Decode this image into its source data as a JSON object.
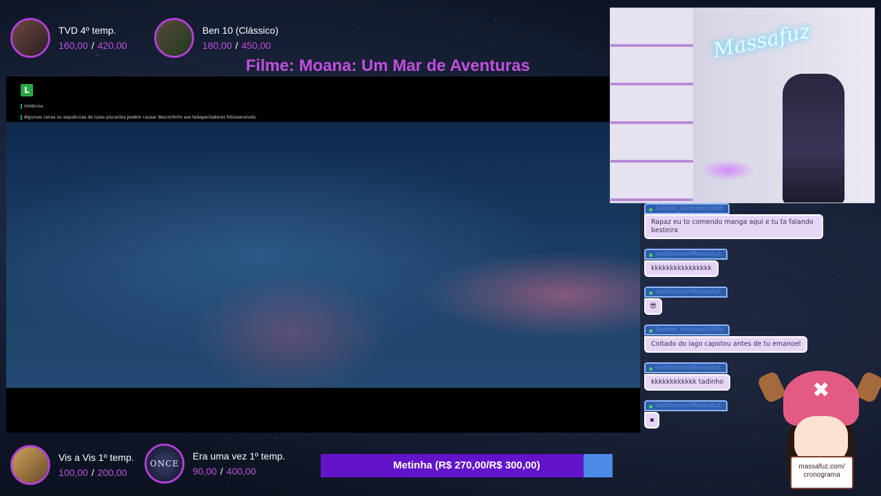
{
  "trackers": {
    "tvd": {
      "title": "TVD 4º temp.",
      "current": "160,00",
      "goal": "420,00"
    },
    "ben10": {
      "title": "Ben 10 (Clássico)",
      "current": "180,00",
      "goal": "450,00"
    },
    "vis": {
      "title": "Vis a Vis 1º temp.",
      "current": "100,00",
      "goal": "200,00"
    },
    "once": {
      "title": "Era uma vez 1º temp.",
      "current": "90,00",
      "goal": "400,00",
      "logo": "ONCE"
    }
  },
  "separator": "/",
  "movie_title": "Filme: Moana: Um Mar de Aventuras",
  "video": {
    "rating": "L",
    "rating_desc": "Violência",
    "warning": "Algumas cenas ou sequências de luzes piscantes podem causar desconforto aos telespectadores fotossensíveis."
  },
  "webcam": {
    "neon_sign": "Massafuz"
  },
  "chat": [
    {
      "user": "Senhor_Andrade1998:",
      "text": "Rapaz eu to comendo manga aqui e tu ta falando besteira"
    },
    {
      "user": "vaiEmanoelMassafuz:",
      "text": "kkkkkkkkkkkkkkkk"
    },
    {
      "user": "vaiEmanoelMassafuz:",
      "text": "😎"
    },
    {
      "user": "Senhor_Andrade1998:",
      "text": "Coitado do iago capotou antes de tu emanoel"
    },
    {
      "user": "vaiEmanoelMassafuz:",
      "text": "kkkkkkkkkkkk tadinho"
    },
    {
      "user": "vaiEmanoelMassafuz:",
      "text": "▪"
    }
  ],
  "goal": {
    "label": "Metinha (R$ 270,00/R$ 300,00)",
    "progress": 0.9
  },
  "mascot": {
    "hat_icon": "x-cross-icon",
    "sign_line1": "massafuz.com/",
    "sign_line2": "cronograma"
  }
}
